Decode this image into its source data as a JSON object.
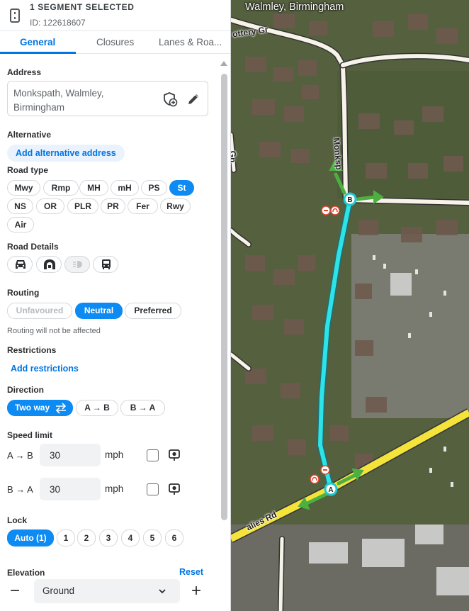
{
  "header": {
    "title": "1 SEGMENT SELECTED",
    "id_text": "ID: 122618607",
    "icon": "segment-icon"
  },
  "tabs": [
    {
      "label": "General",
      "active": true
    },
    {
      "label": "Closures",
      "active": false
    },
    {
      "label": "Lanes & Roa...",
      "active": false
    }
  ],
  "address": {
    "label": "Address",
    "line1": "Monkspath, Walmley,",
    "line2": "Birmingham",
    "icons": [
      "shield-add-icon",
      "pencil-icon"
    ]
  },
  "alternative": {
    "label": "Alternative",
    "button": "Add alternative address"
  },
  "road_type": {
    "label": "Road type",
    "options": [
      "Mwy",
      "Rmp",
      "MH",
      "mH",
      "PS",
      "St",
      "NS",
      "OR",
      "PLR",
      "PR",
      "Fer",
      "Rwy",
      "Air"
    ],
    "selected": "St"
  },
  "road_details": {
    "label": "Road Details",
    "icons": [
      "car-icon",
      "tunnel-icon",
      "headlights-icon",
      "bus-icon"
    ]
  },
  "routing": {
    "label": "Routing",
    "options": [
      "Unfavoured",
      "Neutral",
      "Preferred"
    ],
    "selected": "Neutral",
    "note": "Routing will not be affected"
  },
  "restrictions": {
    "label": "Restrictions",
    "link": "Add restrictions"
  },
  "direction": {
    "label": "Direction",
    "options": [
      "Two way",
      "A → B",
      "B → A"
    ],
    "selected": "Two way"
  },
  "speed_limit": {
    "label": "Speed limit",
    "rows": [
      {
        "dir": "A → B",
        "value": "30",
        "unit": "mph"
      },
      {
        "dir": "B → A",
        "value": "30",
        "unit": "mph"
      }
    ]
  },
  "lock": {
    "label": "Lock",
    "options": [
      "Auto (1)",
      "1",
      "2",
      "3",
      "4",
      "5",
      "6"
    ],
    "selected": "Auto (1)"
  },
  "elevation": {
    "label": "Elevation",
    "reset": "Reset",
    "value": "Ground",
    "minus": "−",
    "plus": "+"
  },
  "map": {
    "title": "Walmley, Birmingham",
    "streets": [
      "Monksp",
      "ottery Gr",
      "Gn",
      "alies Rd"
    ],
    "node_a": "A",
    "node_b": "B",
    "colors": {
      "selected_segment": "#2ee3e8",
      "arrows": "#4caf3f",
      "main_road": "#f3e33a"
    }
  }
}
